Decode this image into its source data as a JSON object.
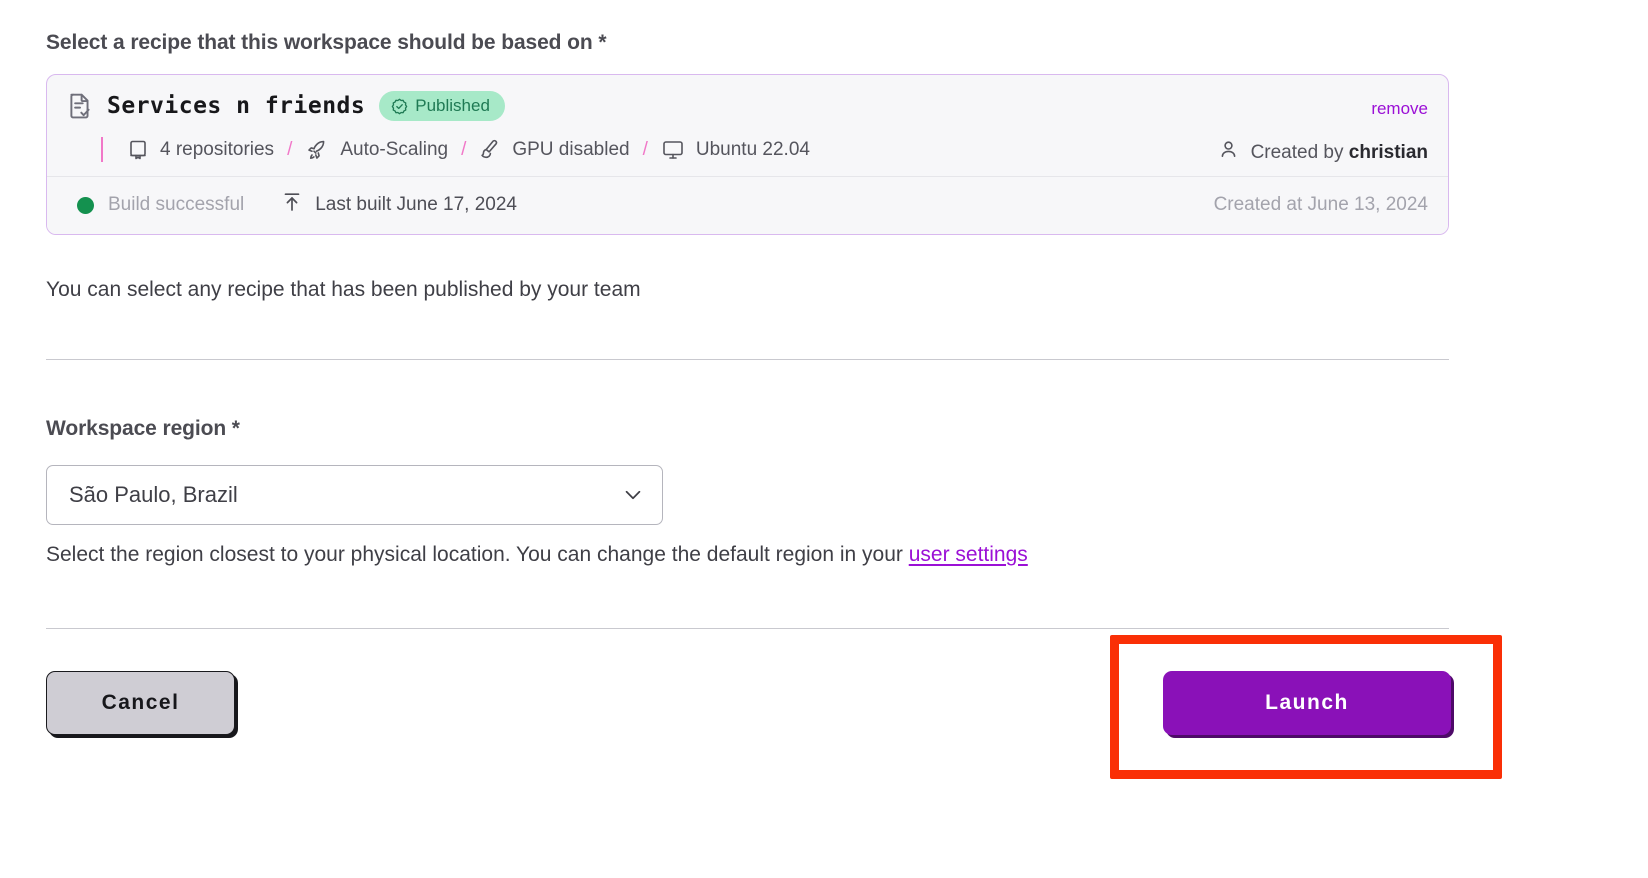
{
  "form": {
    "recipe_label": "Select a recipe that this workspace should be based on *",
    "recipe_helper": "You can select any recipe that has been published by your team",
    "region_label": "Workspace region *",
    "region_helper_prefix": "Select the region closest to your physical location. You can change the default region in your ",
    "region_helper_link": "user settings"
  },
  "recipe_card": {
    "title": "Services n friends",
    "status_badge": "Published",
    "remove_label": "remove",
    "meta": [
      {
        "icon": "repository-icon",
        "label": "4 repositories"
      },
      {
        "icon": "rocket-icon",
        "label": "Auto-Scaling"
      },
      {
        "icon": "brush-icon",
        "label": "GPU disabled"
      },
      {
        "icon": "monitor-icon",
        "label": "Ubuntu 22.04"
      }
    ],
    "separator": "/",
    "created_by_prefix": "Created by ",
    "created_by_user": "christian",
    "build_status": "Build successful",
    "last_built": "Last built June 17, 2024",
    "created_at": "Created at June 13, 2024"
  },
  "region_select": {
    "value": "São Paulo, Brazil"
  },
  "actions": {
    "cancel_label": "Cancel",
    "launch_label": "Launch"
  },
  "colors": {
    "accent_purple": "#9b10d6",
    "launch_purple": "#8a11b8",
    "badge_green_bg": "#a7e9c8",
    "badge_green_text": "#1f7a54",
    "status_dot_green": "#14914f",
    "separator_pink": "#f178c8",
    "card_border": "#d9b9ef",
    "highlight_red": "#fa2f06"
  }
}
